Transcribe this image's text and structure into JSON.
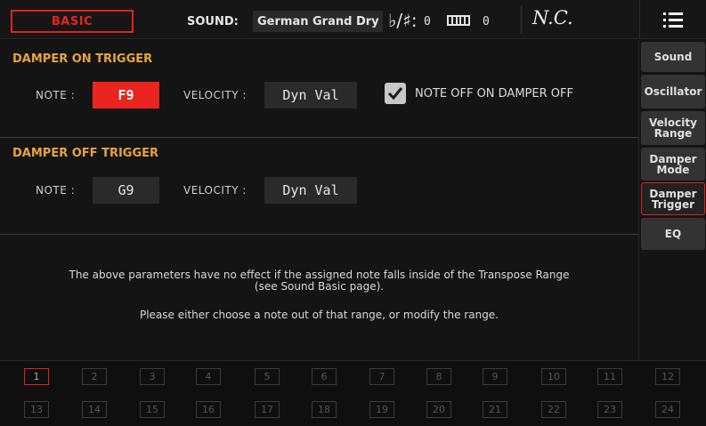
{
  "header": {
    "mode": "BASIC",
    "sound_label": "SOUND:",
    "sound_name": "German Grand Dry",
    "flat_sharp_symbol": "♭/♯:",
    "transpose_value": "0",
    "octave_value": "0",
    "chord": "N.C."
  },
  "damper_on": {
    "title": "DAMPER ON TRIGGER",
    "note_label": "NOTE :",
    "note_value": "F9",
    "velocity_label": "VELOCITY :",
    "velocity_value": "Dyn Val",
    "checkbox_checked": true,
    "checkbox_label": "NOTE OFF ON DAMPER OFF"
  },
  "damper_off": {
    "title": "DAMPER OFF TRIGGER",
    "note_label": "NOTE :",
    "note_value": "G9",
    "velocity_label": "VELOCITY :",
    "velocity_value": "Dyn Val"
  },
  "info": {
    "line1": "The above parameters have no effect if the assigned note falls inside of the Transpose Range",
    "line2": "(see Sound Basic page).",
    "line3": "Please either choose a note out of that range, or modify the range."
  },
  "tabs": [
    {
      "label": "Sound"
    },
    {
      "label": "Oscillator"
    },
    {
      "label": "Velocity Range"
    },
    {
      "label": "Damper Mode"
    },
    {
      "label": "Damper Trigger",
      "selected": true
    },
    {
      "label": "EQ"
    }
  ],
  "pads": [
    "1",
    "2",
    "3",
    "4",
    "5",
    "6",
    "7",
    "8",
    "9",
    "10",
    "11",
    "12",
    "13",
    "14",
    "15",
    "16",
    "17",
    "18",
    "19",
    "20",
    "21",
    "22",
    "23",
    "24"
  ],
  "selected_pad": "1",
  "colors": {
    "accent_red": "#e8251e",
    "section_title": "#e8a43c"
  }
}
